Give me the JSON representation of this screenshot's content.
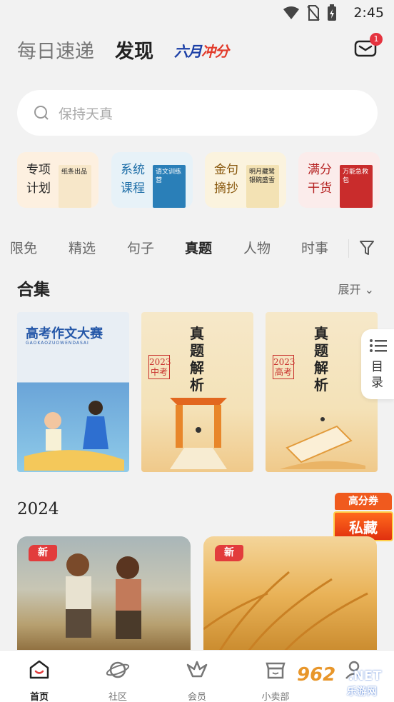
{
  "status_bar": {
    "time": "2:45"
  },
  "top_nav": {
    "tab_daily": "每日速递",
    "tab_discover": "发现",
    "promo_prefix": "六月",
    "promo_suffix": "冲分",
    "mail_badge": "1"
  },
  "search": {
    "placeholder": "保持天真"
  },
  "feature_cards": [
    {
      "label": "专项计划",
      "book_text": "纸条出品",
      "bg": "#fdf0e0",
      "book_bg": "#f7e7c9"
    },
    {
      "label": "系统课程",
      "book_text": "语文训练营",
      "bg": "#e7f2f8",
      "book_bg": "#2a7fb8"
    },
    {
      "label": "金句摘抄",
      "book_text": "明月藏鹭 银碗盛雪",
      "bg": "#fbf3de",
      "book_bg": "#f3e2b4"
    },
    {
      "label": "满分干货",
      "book_text": "万能急救包",
      "bg": "#fbeceb",
      "book_bg": "#c92c2c"
    }
  ],
  "categories": [
    "限免",
    "精选",
    "句子",
    "真题",
    "人物",
    "时事"
  ],
  "active_category": "真题",
  "collection": {
    "title": "合集",
    "expand_label": "展开",
    "covers": [
      {
        "title": "高考作文大赛",
        "subtitle": "GAOKAOZUOWENDASAI"
      },
      {
        "title": "真题解析",
        "tag": "2023中考"
      },
      {
        "title": "真题解析",
        "tag": "2023高考"
      }
    ]
  },
  "side_index": {
    "label": "目录"
  },
  "promo_chest": {
    "top": "高分券",
    "bottom": "私藏"
  },
  "year_section": {
    "title": "2024",
    "tiles": [
      {
        "badge": "新"
      },
      {
        "badge": "新"
      }
    ]
  },
  "tab_bar": {
    "items": [
      {
        "label": "首页",
        "icon": "home-icon"
      },
      {
        "label": "社区",
        "icon": "planet-icon"
      },
      {
        "label": "会员",
        "icon": "crown-icon"
      },
      {
        "label": "小卖部",
        "icon": "shop-icon"
      },
      {
        "label": "",
        "icon": "profile-icon"
      }
    ],
    "active": "首页"
  },
  "watermark": {
    "number": "962",
    "net": ".NET",
    "site": "乐游网"
  },
  "colors": {
    "accent_red": "#e23c3c",
    "promo_blue": "#1b3fa6",
    "background": "#f2f2f2"
  }
}
